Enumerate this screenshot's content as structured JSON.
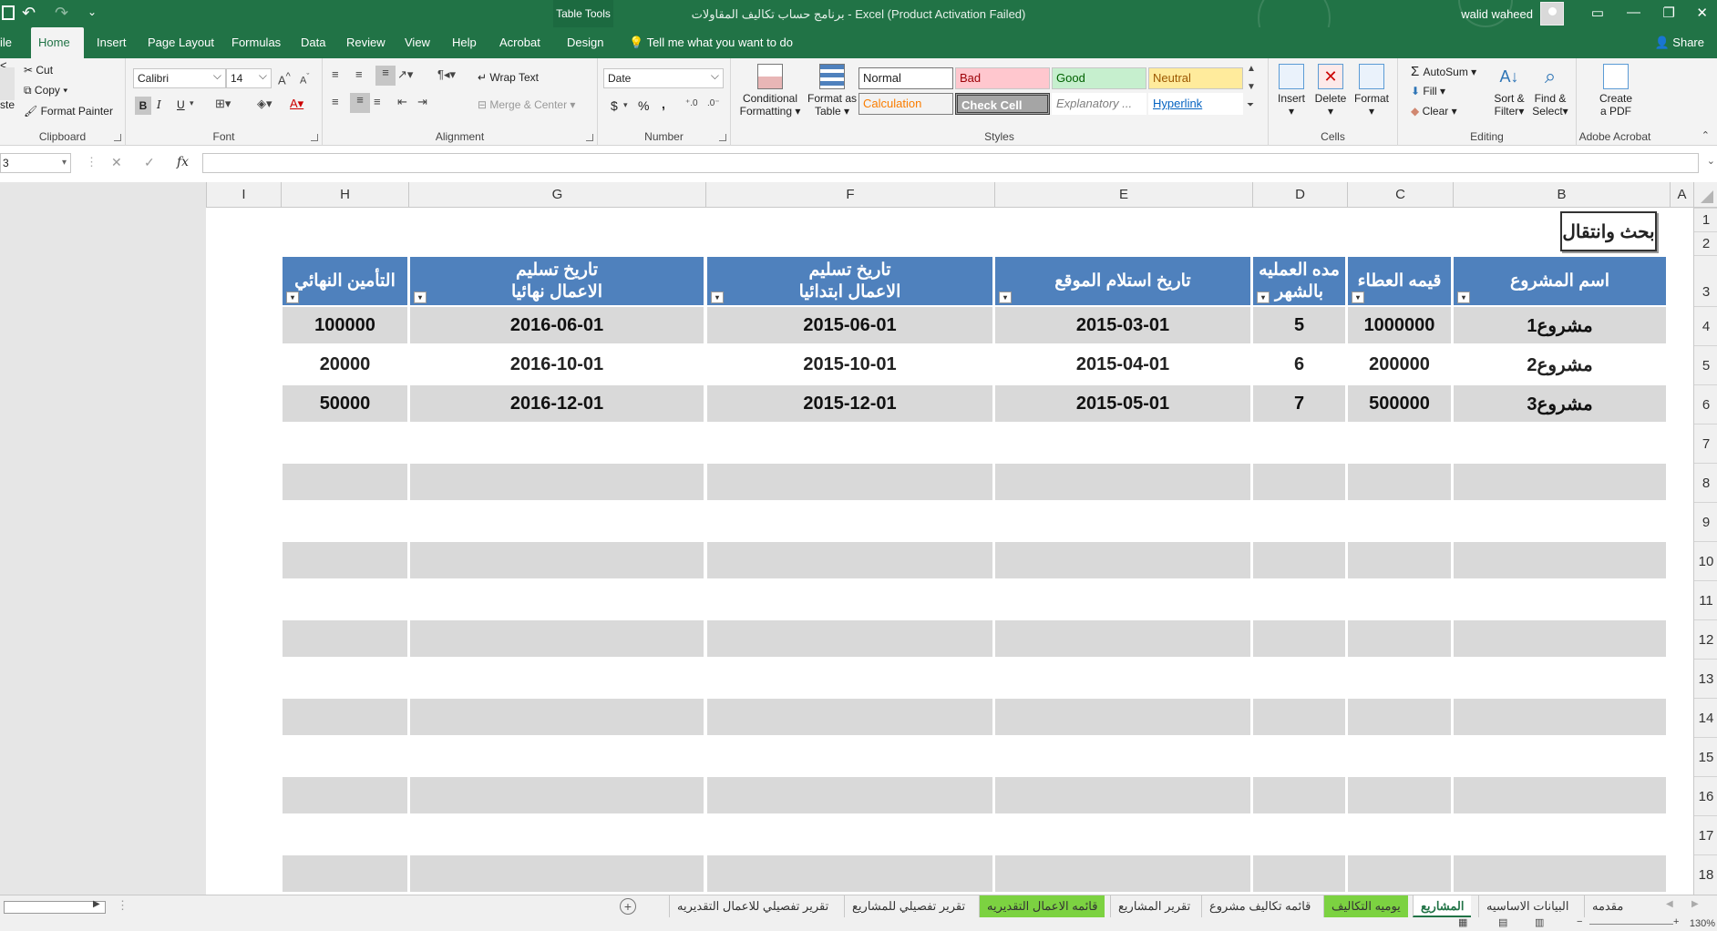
{
  "titlebar": {
    "context_tab": "Table Tools",
    "title": "برنامج حساب تكاليف المقاولات  -  Excel (Product Activation Failed)",
    "user": "walid waheed"
  },
  "tabs": [
    "ile",
    "Home",
    "Insert",
    "Page Layout",
    "Formulas",
    "Data",
    "Review",
    "View",
    "Help",
    "Acrobat",
    "Design"
  ],
  "tellme": "Tell me what you want to do",
  "share": "Share",
  "ribbon": {
    "clipboard": {
      "paste": "ste",
      "cut": "Cut",
      "copy": "Copy",
      "format_painter": "Format Painter",
      "label": "Clipboard"
    },
    "font": {
      "name": "Calibri",
      "size": "14",
      "bold": "B",
      "italic": "I",
      "underline": "U",
      "label": "Font"
    },
    "alignment": {
      "wrap": "Wrap Text",
      "merge": "Merge & Center",
      "label": "Alignment"
    },
    "number": {
      "format": "Date",
      "currency": "$",
      "percent": "%",
      "comma": ",",
      "label": "Number"
    },
    "styles": {
      "conditional": [
        "Conditional",
        "Formatting"
      ],
      "format_table": [
        "Format as",
        "Table"
      ],
      "normal": "Normal",
      "bad": "Bad",
      "good": "Good",
      "neutral": "Neutral",
      "calculation": "Calculation",
      "check": "Check Cell",
      "explanatory": "Explanatory ...",
      "hyperlink": "Hyperlink",
      "label": "Styles"
    },
    "cells": {
      "insert": "Insert",
      "delete": "Delete",
      "format": "Format",
      "label": "Cells"
    },
    "editing": {
      "autosum": "AutoSum",
      "fill": "Fill",
      "clear": "Clear",
      "sort": [
        "Sort &",
        "Filter"
      ],
      "find": [
        "Find &",
        "Select"
      ],
      "label": "Editing"
    },
    "acrobat": {
      "create": [
        "Create",
        "a PDF"
      ],
      "label": "Adobe Acrobat"
    }
  },
  "namebox": "3",
  "fx": "fx",
  "columns": [
    "I",
    "H",
    "G",
    "F",
    "E",
    "D",
    "C",
    "B",
    "A"
  ],
  "rows": [
    "1",
    "2",
    "3",
    "4",
    "5",
    "6",
    "7",
    "8",
    "9",
    "10",
    "11",
    "12",
    "13",
    "14",
    "15",
    "16",
    "17",
    "18"
  ],
  "search_button": "بحث وانتقال",
  "table": {
    "headers": {
      "B": [
        "اسم المشروع"
      ],
      "C": [
        "قيمه العطاء"
      ],
      "D": [
        "مده العمليه",
        "بالشهر"
      ],
      "E": [
        "تاريخ استلام الموقع"
      ],
      "F": [
        "تاريخ تسليم",
        "الاعمال ابتدائيا"
      ],
      "G": [
        "تاريخ تسليم",
        "الاعمال نهائيا"
      ],
      "H": [
        "التأمين النهائي"
      ]
    },
    "rows": [
      {
        "B": "مشروع1",
        "C": "1000000",
        "D": "5",
        "E": "2015-03-01",
        "F": "2015-06-01",
        "G": "2016-06-01",
        "H": "100000"
      },
      {
        "B": "مشروع2",
        "C": "200000",
        "D": "6",
        "E": "2015-04-01",
        "F": "2015-10-01",
        "G": "2016-10-01",
        "H": "20000"
      },
      {
        "B": "مشروع3",
        "C": "500000",
        "D": "7",
        "E": "2015-05-01",
        "F": "2015-12-01",
        "G": "2016-12-01",
        "H": "50000"
      }
    ]
  },
  "sheet_tabs": [
    {
      "label": "مقدمه",
      "style": "normal"
    },
    {
      "label": "البيانات الاساسيه",
      "style": "normal"
    },
    {
      "label": "المشاريع",
      "style": "active"
    },
    {
      "label": "يوميه التكاليف",
      "style": "green"
    },
    {
      "label": "قائمه تكاليف مشروع",
      "style": "normal"
    },
    {
      "label": "تقرير المشاريع",
      "style": "normal"
    },
    {
      "label": "قائمه الاعمال التقديريه",
      "style": "green"
    },
    {
      "label": "تقرير تفصيلي للمشاريع",
      "style": "normal"
    },
    {
      "label": "تقرير تفصيلي للاعمال التقديريه",
      "style": "normal"
    }
  ],
  "zoom": "130%",
  "colors": {
    "excel_green": "#217346",
    "table_header": "#4f81bd",
    "table_band": "#d9d9d9",
    "tab_green": "#7cd241"
  }
}
